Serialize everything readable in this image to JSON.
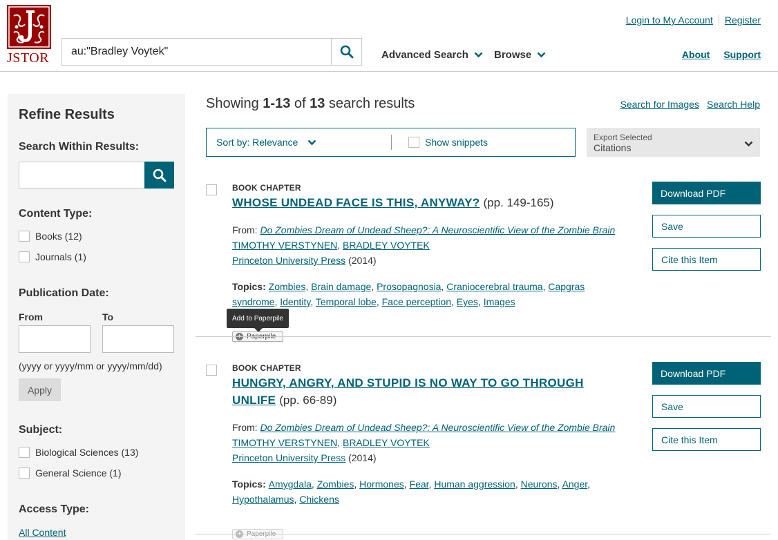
{
  "header": {
    "logo_text": "JSTOR",
    "search_value": "au:\"Bradley Voytek\"",
    "nav": [
      "Advanced Search",
      "Browse"
    ],
    "top_links": [
      "Login to My Account",
      "Register"
    ],
    "bottom_links": [
      "About",
      "Support"
    ]
  },
  "sidebar": {
    "title": "Refine Results",
    "search_within": "Search Within Results:",
    "content_type": {
      "heading": "Content Type:",
      "items": [
        "Books (12)",
        "Journals (1)"
      ]
    },
    "pub_date": {
      "heading": "Publication Date:",
      "from": "From",
      "to": "To",
      "hint": "(yyyy or yyyy/mm or yyyy/mm/dd)",
      "apply": "Apply"
    },
    "subject": {
      "heading": "Subject:",
      "items": [
        "Biological Sciences (13)",
        "General Science (1)"
      ]
    },
    "access": {
      "heading": "Access Type:",
      "link": "All Content"
    }
  },
  "main": {
    "showing_prefix": "Showing ",
    "showing_range": "1-13",
    "showing_of": " of ",
    "showing_total": "13",
    "showing_suffix": " search results",
    "help_links": [
      "Search for Images",
      "Search Help"
    ],
    "sort_label": "Sort by: Relevance",
    "snippets_label": "Show snippets",
    "export_line1": "Export Selected",
    "export_line2": "Citations",
    "tooltip": "Add to Paperpile",
    "paperpile_label": "Paperpile",
    "buttons": {
      "download": "Download PDF",
      "save": "Save",
      "cite": "Cite this Item"
    },
    "results": [
      {
        "type": "BOOK CHAPTER",
        "title": "WHOSE UNDEAD FACE IS THIS, ANYWAY?",
        "pages": "(pp. 149-165)",
        "from_label": "From: ",
        "book": "Do Zombies Dream of Undead Sheep?: A Neuroscientific View of the Zombie Brain",
        "authors": [
          "TIMOTHY VERSTYNEN",
          "BRADLEY VOYTEK"
        ],
        "publisher": "Princeton University Press",
        "year": "(2014)",
        "topics_label": "Topics: ",
        "topics": [
          "Zombies",
          "Brain damage",
          "Prosopagnosia",
          "Craniocerebral trauma",
          "Capgras syndrome",
          "Identity",
          "Temporal lobe",
          "Face perception",
          "Eyes",
          "Images"
        ]
      },
      {
        "type": "BOOK CHAPTER",
        "title": "HUNGRY, ANGRY, AND STUPID IS NO WAY TO GO THROUGH UNLIFE",
        "pages": "(pp. 66-89)",
        "from_label": "From: ",
        "book": "Do Zombies Dream of Undead Sheep?: A Neuroscientific View of the Zombie Brain",
        "authors": [
          "TIMOTHY VERSTYNEN",
          "BRADLEY VOYTEK"
        ],
        "publisher": "Princeton University Press",
        "year": "(2014)",
        "topics_label": "Topics: ",
        "topics": [
          "Amygdala",
          "Zombies",
          "Hormones",
          "Fear",
          "Human aggression",
          "Neurons",
          "Anger",
          "Hypothalamus",
          "Chickens"
        ]
      }
    ]
  },
  "colors": {
    "brand": "#990000",
    "accent": "#006276"
  }
}
